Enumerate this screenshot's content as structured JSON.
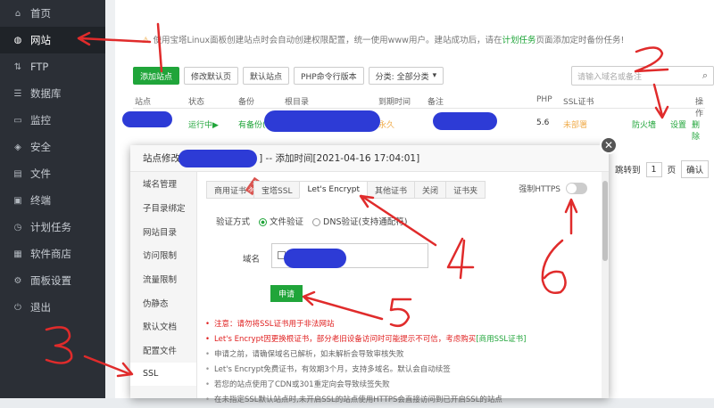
{
  "sidebar": {
    "items": [
      {
        "icon": "home-icon",
        "label": "首页",
        "active": false
      },
      {
        "icon": "globe-icon",
        "label": "网站",
        "active": true
      },
      {
        "icon": "ftp-icon",
        "label": "FTP",
        "active": false
      },
      {
        "icon": "database-icon",
        "label": "数据库",
        "active": false
      },
      {
        "icon": "monitor-icon",
        "label": "监控",
        "active": false
      },
      {
        "icon": "shield-icon",
        "label": "安全",
        "active": false
      },
      {
        "icon": "folder-icon",
        "label": "文件",
        "active": false
      },
      {
        "icon": "terminal-icon",
        "label": "终端",
        "active": false
      },
      {
        "icon": "clock-icon",
        "label": "计划任务",
        "active": false
      },
      {
        "icon": "store-icon",
        "label": "软件商店",
        "active": false
      },
      {
        "icon": "gear-icon",
        "label": "面板设置",
        "active": false
      },
      {
        "icon": "logout-icon",
        "label": "退出",
        "active": false
      }
    ]
  },
  "notice": {
    "text": "使用宝塔Linux面板创建站点时会自动创建权限配置，统一使用www用户。建站成功后，请在",
    "link": "计划任务",
    "tail": "页面添加定时备份任务!"
  },
  "toolbar": {
    "add_site": "添加站点",
    "default_page": "修改默认页",
    "default_site": "默认站点",
    "php_cli": "PHP命令行版本",
    "category": "分类: 全部分类"
  },
  "search": {
    "placeholder": "请输入域名或备注"
  },
  "table": {
    "headers": [
      "站点",
      "状态",
      "备份",
      "根目录",
      "到期时间",
      "备注",
      "PHP",
      "SSL证书",
      "操作"
    ],
    "row": {
      "status": "运行中▶",
      "backup": "有备份(10)",
      "expire": "永久",
      "php": "5.6",
      "ssl": "未部署",
      "firewall": "防火墙",
      "settings": "设置",
      "delete": "删除"
    }
  },
  "pager": {
    "goto": "跳转到",
    "page": "1",
    "unit": "页",
    "confirm": "确认"
  },
  "modal": {
    "title_prefix": "站点修改[",
    "title_suffix": "] -- 添加时间[2021-04-16 17:04:01]",
    "close": "✕",
    "side_items": [
      "域名管理",
      "子目录绑定",
      "网站目录",
      "访问限制",
      "流量限制",
      "伪静态",
      "默认文档",
      "配置文件",
      "SSL"
    ],
    "tabs": [
      {
        "label": "商用证书",
        "hot": "推荐",
        "active": false
      },
      {
        "label": "宝塔SSL",
        "active": false
      },
      {
        "label": "Let's Encrypt",
        "active": true
      },
      {
        "label": "其他证书",
        "active": false
      },
      {
        "label": "关闭",
        "active": false
      },
      {
        "label": "证书夹",
        "active": false
      }
    ],
    "force_https": "强制HTTPS",
    "verify_label": "验证方式",
    "verify_file": "文件验证",
    "verify_dns": "DNS验证(支持通配符)",
    "domain_label": "域名",
    "apply": "申请",
    "tips": [
      {
        "text": "注意：请勿将SSL证书用于非法网站",
        "red": true
      },
      {
        "text": "Let's Encrypt因更换根证书，部分老旧设备访问时可能提示不可信，考虑购买",
        "link": "[商用SSL证书]",
        "red": true
      },
      {
        "text": "申请之前，请确保域名已解析，如未解析会导致审核失败",
        "red": false
      },
      {
        "text": "Let's Encrypt免费证书，有效期3个月，支持多域名。默认会自动续签",
        "red": false
      },
      {
        "text": "若您的站点使用了CDN或301重定向会导致续签失败",
        "red": false
      },
      {
        "text": "在未指定SSL默认站点时,未开启SSL的站点使用HTTPS会直接访问到已开启SSL的站点",
        "red": false
      }
    ]
  },
  "annotations": {
    "numbers": [
      "1",
      "2",
      "3",
      "4",
      "5",
      "6"
    ],
    "color": "#e02b2b"
  },
  "colors": {
    "accent": "#20a53a",
    "sidebar": "#2b2f36",
    "redact": "#2d3bd6"
  }
}
